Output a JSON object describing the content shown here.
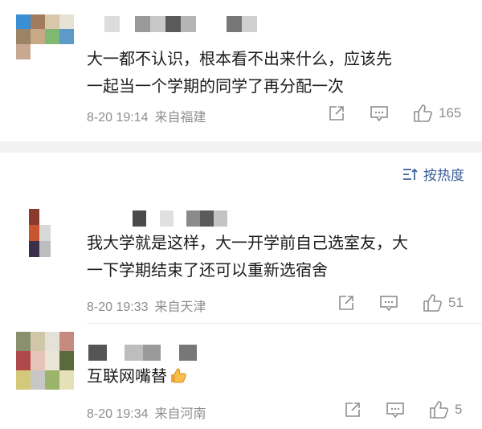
{
  "comments": [
    {
      "text_line1": "大一都不认识，根本看不出来什么，应该先",
      "text_line2": "一起当一个学期的同学了再分配一次",
      "date": "8-20 19:14",
      "location": "来自福建",
      "like_count": "165",
      "avatar_colors": [
        "#3a8fd4",
        "#a07c5c",
        "#d8c7a8",
        "#e6e2d6",
        "#9b8365",
        "#c7a987",
        "#7fb870",
        "#5c9ac8",
        "#c9a890"
      ],
      "name_colors": [
        "#dcdcdc",
        "#ffffff",
        "#9a9a9a",
        "#c8c8c8",
        "#5a5a5a",
        "#b5b5b5",
        "#ffffff",
        "#ffffff",
        "#777777",
        "#cfcfcf"
      ]
    },
    {
      "text_line1": "我大学就是这样，大一开学前自己选室友，大",
      "text_line2": "一下学期结束了还可以重新选宿舍",
      "date": "8-20 19:33",
      "location": "来自天津",
      "like_count": "51",
      "avatar_colors": [
        "#8a3a2c",
        "#ffffff",
        "#ffffff",
        "#c7552f",
        "#d9d9d9",
        "#ffffff",
        "#3a2e4a",
        "#bdbdbd",
        "#ffffff"
      ],
      "name_colors": [
        "#ffffff",
        "#4a4a4a",
        "#ffffff",
        "#e0e0e0",
        "#ffffff",
        "#8a8a8a",
        "#5a5a5a",
        "#c4c4c4"
      ]
    },
    {
      "text_line1": "互联网嘴替",
      "date": "8-20 19:34",
      "location": "来自河南",
      "like_count": "5",
      "avatar_colors": [
        "#8a8f6e",
        "#cfc7a7",
        "#e4e2d8",
        "#c78a80",
        "#b04a4a",
        "#e7c4b8",
        "#e9e6d6",
        "#5a6a3a",
        "#d4c87a",
        "#c7c7c7",
        "#9ab46a",
        "#e6e0b8"
      ],
      "name_colors": [
        "#555555",
        "#ffffff",
        "#bdbdbd",
        "#9a9a9a",
        "#ffffff",
        "#777777"
      ]
    }
  ],
  "sort_label": "按热度",
  "icons": {
    "share": "share-icon",
    "comment": "comment-icon",
    "like": "thumbs-up-icon",
    "sort": "sort-icon",
    "emoji": "thumbs-up-emoji"
  }
}
